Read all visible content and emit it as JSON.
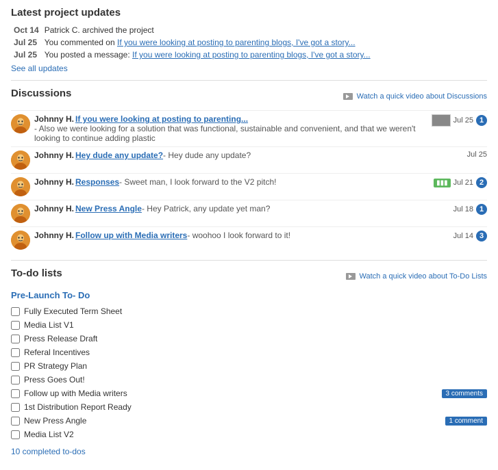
{
  "updates": {
    "title": "Latest project updates",
    "rows": [
      {
        "date": "Oct 14",
        "text": "Patrick C. archived the project",
        "link": null,
        "link_text": null
      },
      {
        "date": "Jul 25",
        "text": "You commented on ",
        "link": "If you were looking at posting to parenting blogs, I've got a story...",
        "link_text": "If you were looking at posting to parenting blogs, I've got a story..."
      },
      {
        "date": "Jul 25",
        "text": "You posted a message: ",
        "link": "If you were looking at posting to parenting blogs, I've got a story...",
        "link_text": "If you were looking at posting to parenting blogs, I've got a story..."
      }
    ],
    "see_all": "See all updates"
  },
  "discussions": {
    "title": "Discussions",
    "video_link": "Watch a quick video about Discussions",
    "items": [
      {
        "user": "Johnny H.",
        "subject": "If you were looking at posting to parenting...",
        "preview": "- Also we were looking for a solution that was functional, sustainable and convenient, and that we weren't looking to continue adding plastic",
        "date": "Jul 25",
        "count": "1",
        "has_thumb": true,
        "has_green": false
      },
      {
        "user": "Johnny H.",
        "subject": "Hey dude any update?",
        "preview": "- Hey dude any update?",
        "date": "Jul 25",
        "count": null,
        "has_thumb": false,
        "has_green": false
      },
      {
        "user": "Johnny H.",
        "subject": "Responses",
        "preview": "- Sweet man, I look forward to the V2 pitch!",
        "date": "Jul 21",
        "count": "2",
        "has_thumb": false,
        "has_green": true
      },
      {
        "user": "Johnny H.",
        "subject": "New Press Angle",
        "preview": "- Hey Patrick, any update yet man?",
        "date": "Jul 18",
        "count": "1",
        "has_thumb": false,
        "has_green": false
      },
      {
        "user": "Johnny H.",
        "subject": "Follow up with Media writers",
        "preview": "- woohoo I look forward to it!",
        "date": "Jul 14",
        "count": "3",
        "has_thumb": false,
        "has_green": false
      }
    ]
  },
  "todos": {
    "title": "To-do lists",
    "video_link": "Watch a quick video about To-Do Lists",
    "list_title": "Pre-Launch To- Do",
    "items": [
      {
        "label": "Fully Executed Term Sheet",
        "badge": null
      },
      {
        "label": "Media List V1",
        "badge": null
      },
      {
        "label": "Press Release Draft",
        "badge": null
      },
      {
        "label": "Referal Incentives",
        "badge": null
      },
      {
        "label": "PR Strategy Plan",
        "badge": null
      },
      {
        "label": "Press Goes Out!",
        "badge": null
      },
      {
        "label": "Follow up with Media writers",
        "badge": "3 comments"
      },
      {
        "label": "1st Distribution Report Ready",
        "badge": null
      },
      {
        "label": "New Press Angle",
        "badge": "1 comment"
      },
      {
        "label": "Media List V2",
        "badge": null
      }
    ],
    "completed": "10 completed to-dos"
  }
}
